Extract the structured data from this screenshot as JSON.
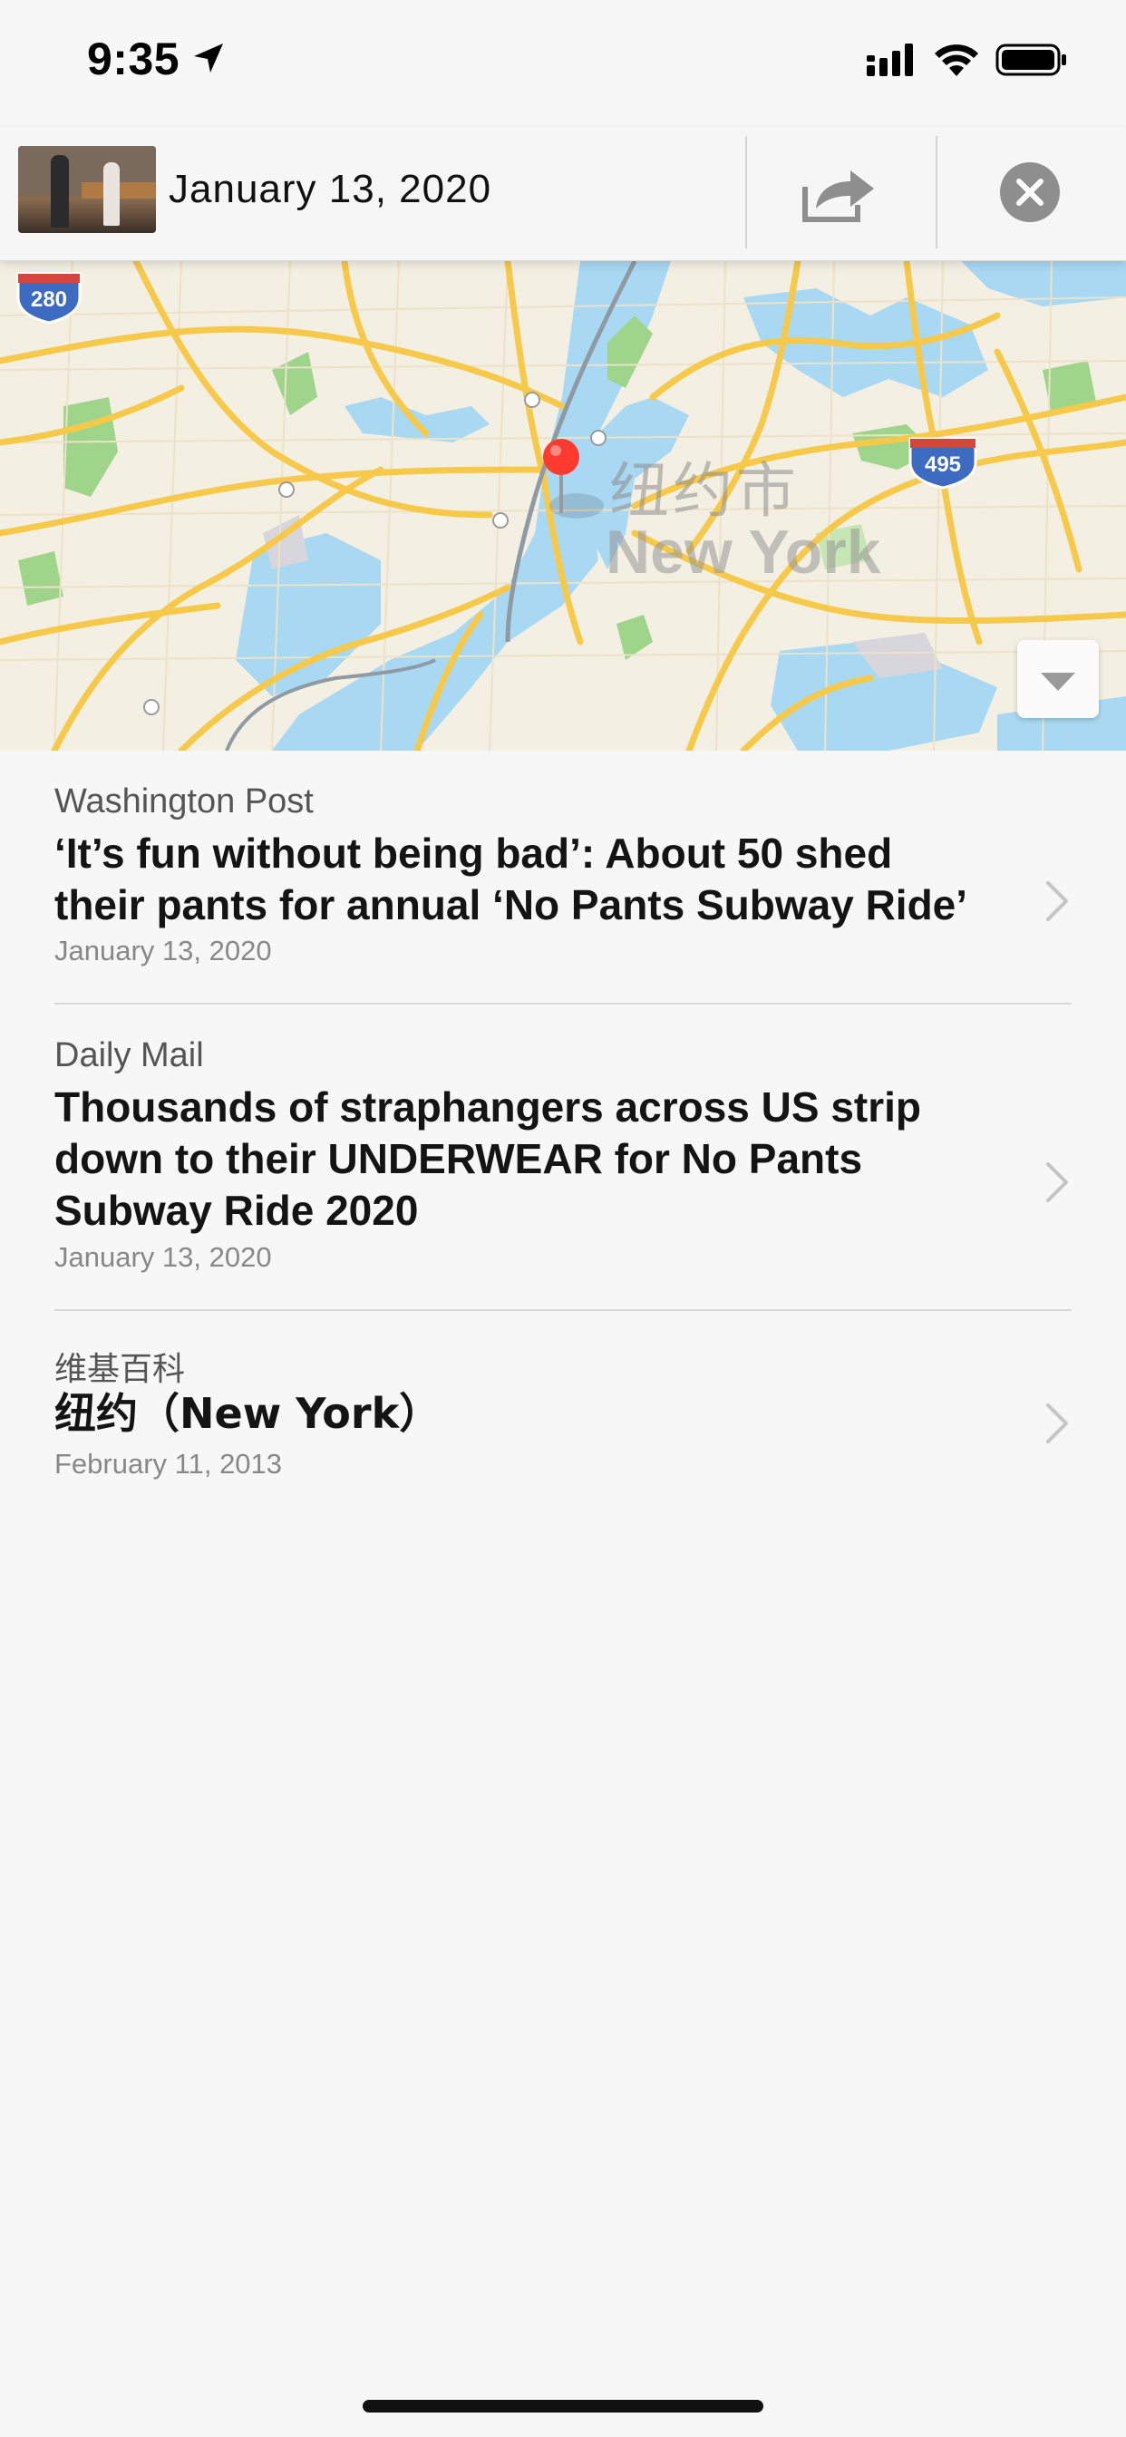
{
  "status_bar": {
    "time": "9:35"
  },
  "header": {
    "title": "January 13, 2020",
    "thumbnail": "photo-thumbnail"
  },
  "map": {
    "city_label_zh": "纽约市",
    "city_label_en": "New York",
    "highway_shields": [
      "280",
      "495"
    ],
    "colors": {
      "land": "#f4efe3",
      "water": "#a9d8f2",
      "roads": "#f6c94a",
      "park": "#9fd58a",
      "pin": "#ff3b30"
    }
  },
  "articles": [
    {
      "source": "Washington Post",
      "headline_line1": "‘It’s fun without being bad’: About 50 shed",
      "headline_line2": "their pants for annual ‘No Pants Subway Ride’",
      "date": "January 13, 2020"
    },
    {
      "source": "Daily Mail",
      "headline_line1": "Thousands of straphangers across US strip",
      "headline_line2": "down to their UNDERWEAR for No Pants",
      "headline_line3": "Subway Ride 2020",
      "date": "January 13, 2020"
    },
    {
      "source": "维基百科",
      "headline_line1": "纽约（New York）",
      "date": "February 11, 2013"
    }
  ]
}
